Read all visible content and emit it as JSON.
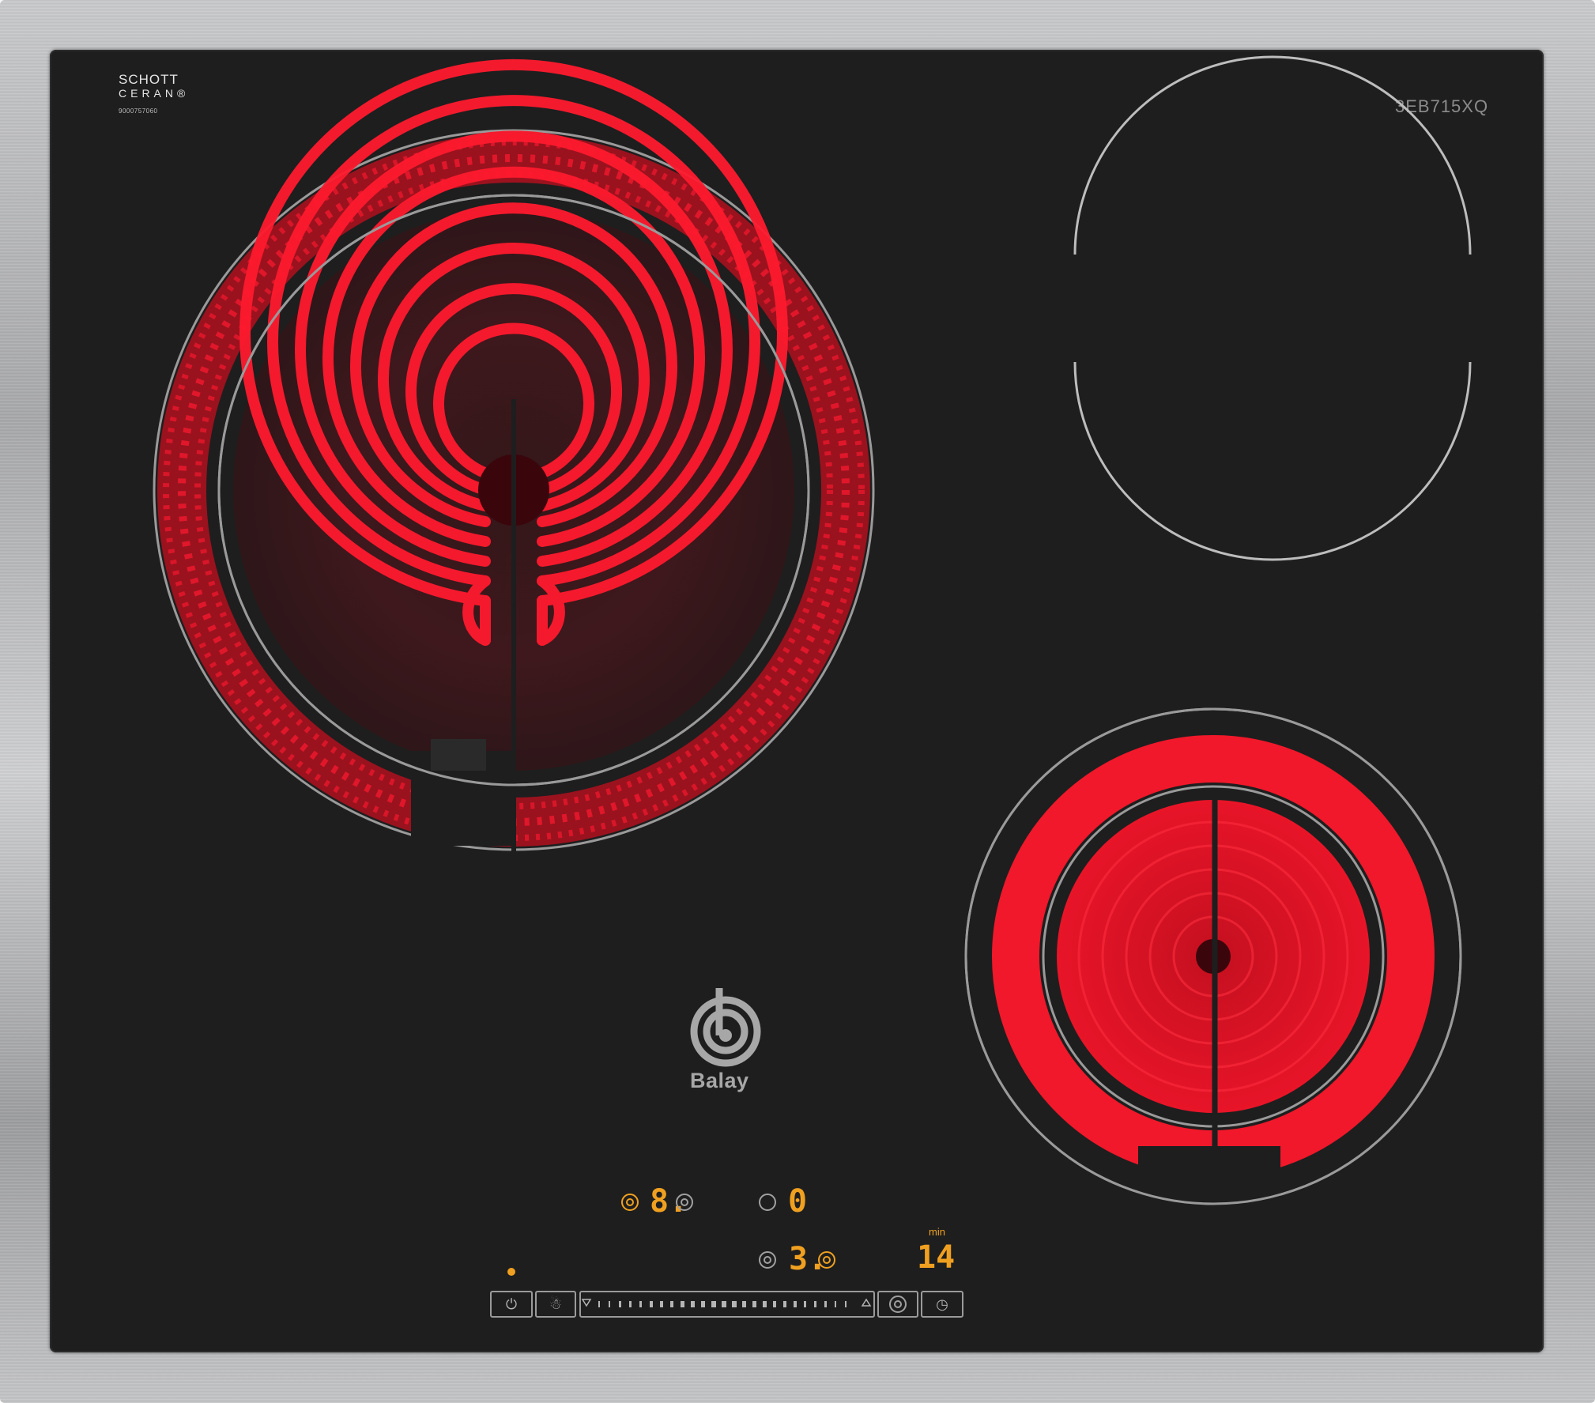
{
  "brand": {
    "glass_line1": "SCHOTT",
    "glass_line2": "CERAN®",
    "serial": "9000757060",
    "model": "3EB715XQ",
    "maker": "Balay"
  },
  "displays": {
    "zone_front_left_level": "8.",
    "zone_rear_right_level": "0",
    "zone_front_right_level": "3.",
    "timer_value": "14",
    "timer_unit": "min"
  },
  "controls": {
    "power_icon": "power-icon",
    "child_lock_icon": "child-lock-icon",
    "slider_down_icon": "triangle-down-icon",
    "slider_up_icon": "triangle-up-icon",
    "zone_select_icon": "dual-zone-icon",
    "timer_icon": "clock-icon"
  },
  "colors": {
    "glass": "#1e1e1e",
    "heat_red": "#ff1a2e",
    "display_orange": "#f0a020",
    "outline_gray": "#a0a0a0"
  }
}
